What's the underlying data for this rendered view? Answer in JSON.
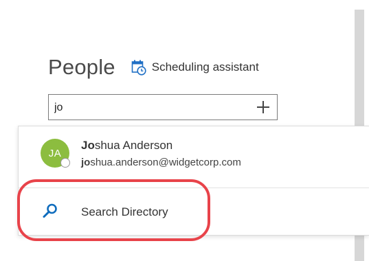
{
  "header": {
    "title": "People",
    "scheduling_assistant_label": "Scheduling assistant"
  },
  "search": {
    "value": "jo",
    "add_icon": "plus-icon"
  },
  "suggestions": [
    {
      "initials": "JA",
      "name_match": "Jo",
      "name_rest": "shua Anderson",
      "email_match": "jo",
      "email_rest": "shua.anderson@widgetcorp.com",
      "avatar_color": "#8cbd3f",
      "presence": "offline"
    }
  ],
  "search_directory": {
    "label": "Search Directory",
    "icon": "search-icon"
  },
  "colors": {
    "accent": "#0f6cbd",
    "callout": "#e8434a"
  }
}
